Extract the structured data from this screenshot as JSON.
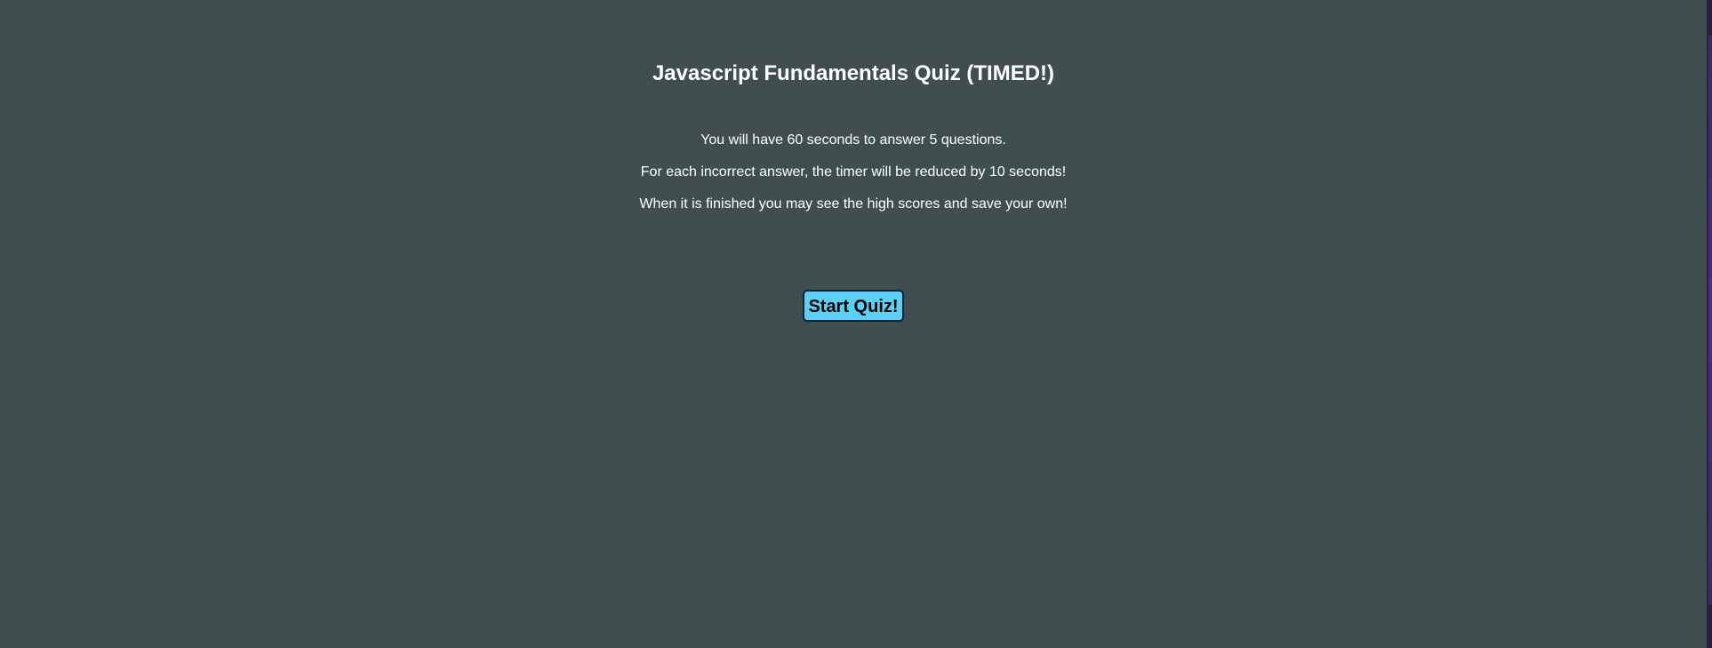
{
  "header": {
    "title": "Javascript Fundamentals Quiz (TIMED!)"
  },
  "intro": {
    "lines": [
      "You will have 60 seconds to answer 5 questions.",
      "For each incorrect answer, the timer will be reduced by 10 seconds!",
      "When it is finished you may see the high scores and save your own!"
    ]
  },
  "actions": {
    "start_label": "Start Quiz!"
  },
  "colors": {
    "background": "#404e50",
    "text": "#ffffff",
    "button_bg": "#5bd0f2",
    "button_border": "#0b2238"
  }
}
